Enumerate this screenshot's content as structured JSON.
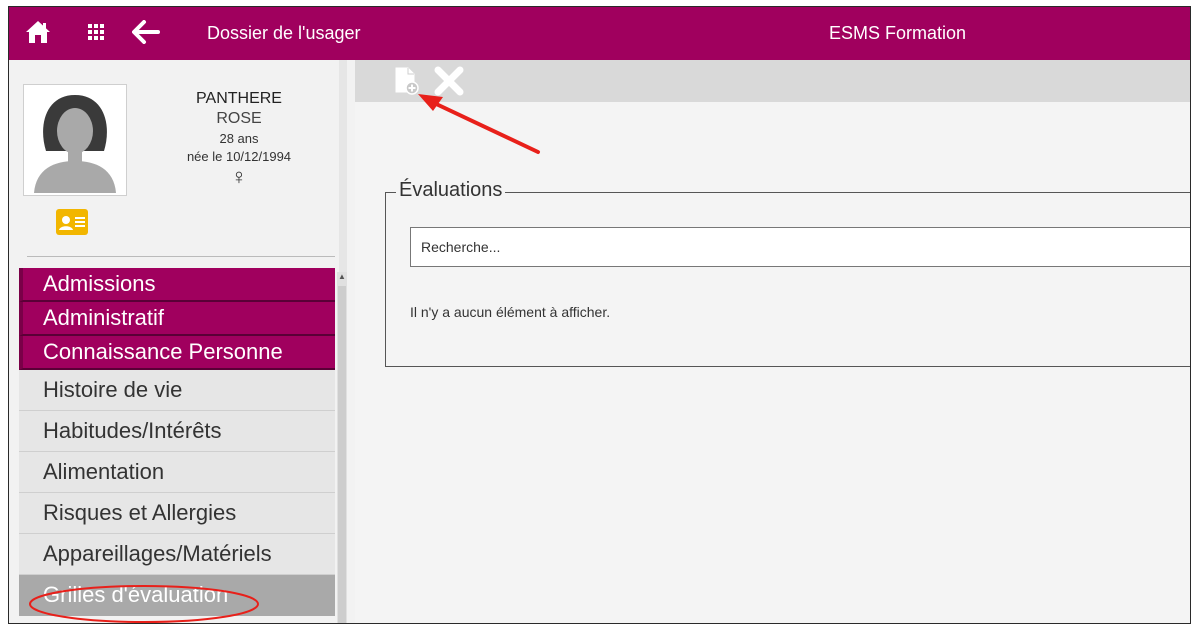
{
  "topbar": {
    "home_icon": "home-icon",
    "grid_icon": "grid-icon",
    "back_icon": "arrow-left-icon",
    "title": "Dossier de l'usager",
    "organization": "ESMS Formation",
    "color": "#a0005e"
  },
  "patient": {
    "last_name": "PANTHERE",
    "first_name": "ROSE",
    "age": "28 ans",
    "birth": "née le 10/12/1994",
    "sex_symbol": "♀",
    "card_icon": "id-card-icon"
  },
  "menu": {
    "primary": [
      {
        "label": "Admissions"
      },
      {
        "label": "Administratif"
      },
      {
        "label": "Connaissance Personne"
      }
    ],
    "secondary": [
      {
        "label": "Histoire de vie"
      },
      {
        "label": "Habitudes/Intérêts"
      },
      {
        "label": "Alimentation"
      },
      {
        "label": "Risques et Allergies"
      },
      {
        "label": "Appareillages/Matériels"
      },
      {
        "label": "Grilles d'évaluation",
        "active": true
      }
    ]
  },
  "toolbar": {
    "new_icon": "new-document-icon",
    "delete_icon": "delete-icon"
  },
  "evaluations": {
    "legend": "Évaluations",
    "search_placeholder": "Recherche...",
    "empty_message": "Il n'y a aucun élément à afficher."
  },
  "annotation_color": "#e8201a"
}
